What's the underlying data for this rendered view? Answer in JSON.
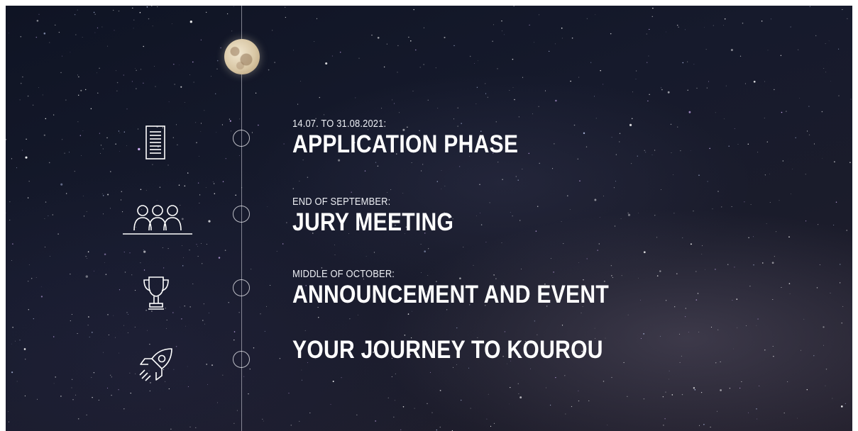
{
  "colors": {
    "text": "#ffffff",
    "line": "#dcdce6",
    "sky": "#161a2c"
  },
  "timeline": [
    {
      "icon": "document-icon",
      "date": "14.07. TO 31.08.2021:",
      "title": "APPLICATION PHASE"
    },
    {
      "icon": "people-icon",
      "date": "END OF SEPTEMBER:",
      "title": "JURY MEETING"
    },
    {
      "icon": "trophy-icon",
      "date": "MIDDLE OF OCTOBER:",
      "title": "ANNOUNCEMENT AND EVENT"
    },
    {
      "icon": "rocket-icon",
      "date": "",
      "title": "YOUR JOURNEY TO KOUROU"
    }
  ]
}
